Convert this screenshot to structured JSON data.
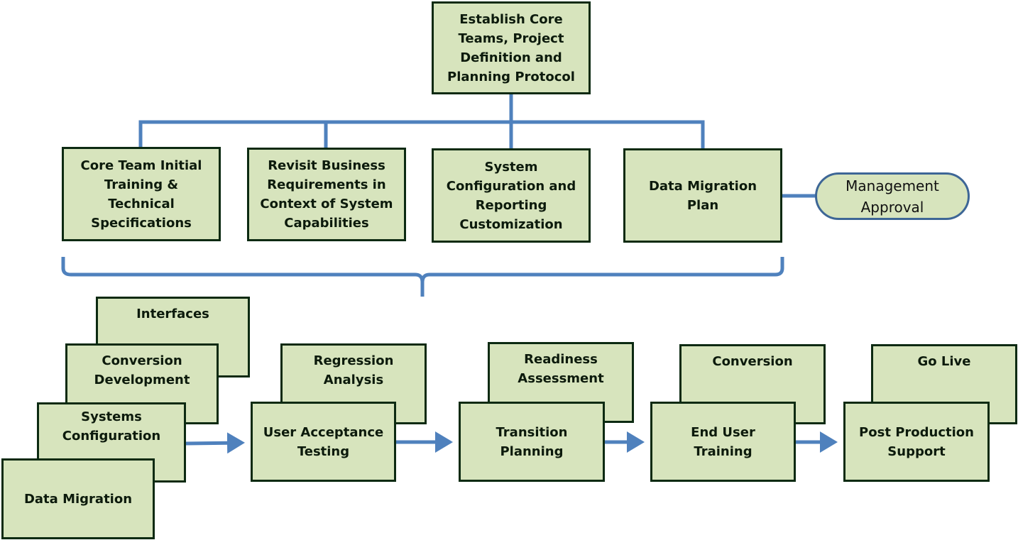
{
  "colors": {
    "box_fill": "#d7e4bd",
    "box_border": "#0c2a12",
    "connector": "#4f81bd"
  },
  "top": {
    "label": "Establish Core\nTeams, Project\nDefinition and\nPlanning Protocol"
  },
  "phase1": [
    {
      "label": "Core Team Initial\nTraining &\nTechnical\nSpecifications"
    },
    {
      "label": "Revisit Business\nRequirements in\nContext of System\nCapabilities"
    },
    {
      "label": "System\nConfiguration and\nReporting\nCustomization"
    },
    {
      "label": "Data Migration\nPlan"
    }
  ],
  "approval": {
    "label": "Management\nApproval"
  },
  "stage1": {
    "stack": [
      "Interfaces",
      "Conversion\nDevelopment",
      "Systems\nConfiguration",
      "Data Migration"
    ]
  },
  "stage2": {
    "back": "Regression\nAnalysis",
    "front": "User Acceptance\nTesting"
  },
  "stage3": {
    "back": "Readiness\nAssessment",
    "front": "Transition\nPlanning"
  },
  "stage4": {
    "back": "Conversion",
    "front": "End User\nTraining"
  },
  "stage5": {
    "back": "Go Live",
    "front": "Post Production\nSupport"
  }
}
